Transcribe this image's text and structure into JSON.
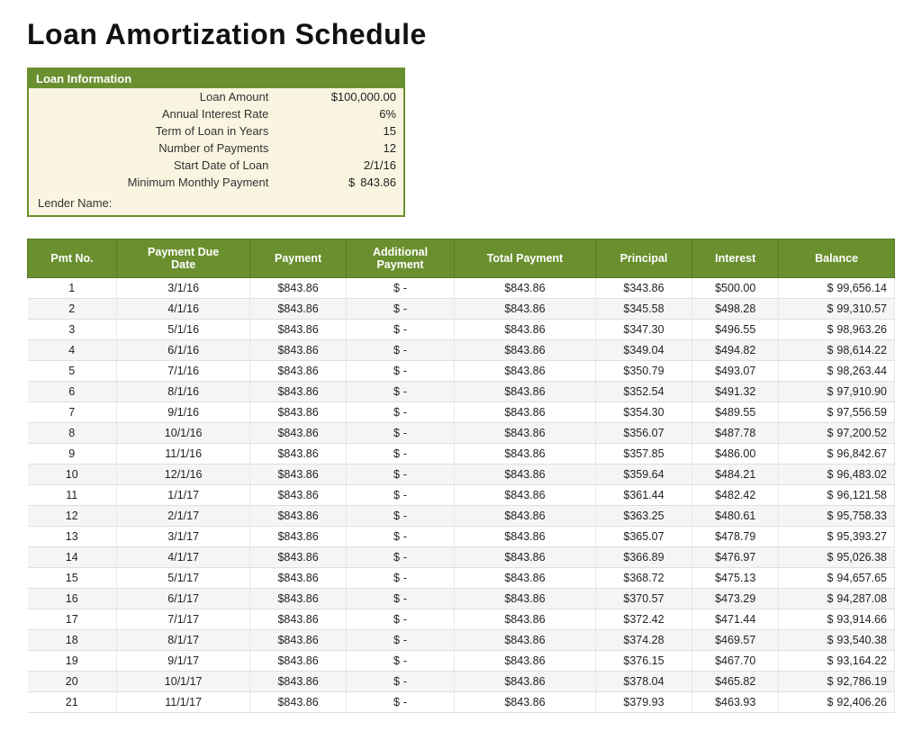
{
  "title": "Loan Amortization Schedule",
  "loanInfo": {
    "sectionTitle": "Loan Information",
    "fields": [
      {
        "label": "Loan Amount",
        "value": "$100,000.00"
      },
      {
        "label": "Annual Interest Rate",
        "value": "6%"
      },
      {
        "label": "Term of Loan in Years",
        "value": "15"
      },
      {
        "label": "Number of Payments",
        "value": "12"
      },
      {
        "label": "Start Date of Loan",
        "value": "2/1/16"
      },
      {
        "label": "Minimum Monthly Payment",
        "value": "843.86",
        "prefix": "$"
      }
    ],
    "lenderLabel": "Lender Name:"
  },
  "table": {
    "headers": [
      "Pmt No.",
      "Payment Due Date",
      "Payment",
      "Additional Payment",
      "Total Payment",
      "Principal",
      "Interest",
      "Balance"
    ],
    "rows": [
      [
        1,
        "3/1/16",
        "$843.86",
        "$",
        "-",
        "$843.86",
        "$343.86",
        "$500.00",
        "$",
        "99,656.14"
      ],
      [
        2,
        "4/1/16",
        "$843.86",
        "$",
        "-",
        "$843.86",
        "$345.58",
        "$498.28",
        "$",
        "99,310.57"
      ],
      [
        3,
        "5/1/16",
        "$843.86",
        "$",
        "-",
        "$843.86",
        "$347.30",
        "$496.55",
        "$",
        "98,963.26"
      ],
      [
        4,
        "6/1/16",
        "$843.86",
        "$",
        "-",
        "$843.86",
        "$349.04",
        "$494.82",
        "$",
        "98,614.22"
      ],
      [
        5,
        "7/1/16",
        "$843.86",
        "$",
        "-",
        "$843.86",
        "$350.79",
        "$493.07",
        "$",
        "98,263.44"
      ],
      [
        6,
        "8/1/16",
        "$843.86",
        "$",
        "-",
        "$843.86",
        "$352.54",
        "$491.32",
        "$",
        "97,910.90"
      ],
      [
        7,
        "9/1/16",
        "$843.86",
        "$",
        "-",
        "$843.86",
        "$354.30",
        "$489.55",
        "$",
        "97,556.59"
      ],
      [
        8,
        "10/1/16",
        "$843.86",
        "$",
        "-",
        "$843.86",
        "$356.07",
        "$487.78",
        "$",
        "97,200.52"
      ],
      [
        9,
        "11/1/16",
        "$843.86",
        "$",
        "-",
        "$843.86",
        "$357.85",
        "$486.00",
        "$",
        "96,842.67"
      ],
      [
        10,
        "12/1/16",
        "$843.86",
        "$",
        "-",
        "$843.86",
        "$359.64",
        "$484.21",
        "$",
        "96,483.02"
      ],
      [
        11,
        "1/1/17",
        "$843.86",
        "$",
        "-",
        "$843.86",
        "$361.44",
        "$482.42",
        "$",
        "96,121.58"
      ],
      [
        12,
        "2/1/17",
        "$843.86",
        "$",
        "-",
        "$843.86",
        "$363.25",
        "$480.61",
        "$",
        "95,758.33"
      ],
      [
        13,
        "3/1/17",
        "$843.86",
        "$",
        "-",
        "$843.86",
        "$365.07",
        "$478.79",
        "$",
        "95,393.27"
      ],
      [
        14,
        "4/1/17",
        "$843.86",
        "$",
        "-",
        "$843.86",
        "$366.89",
        "$476.97",
        "$",
        "95,026.38"
      ],
      [
        15,
        "5/1/17",
        "$843.86",
        "$",
        "-",
        "$843.86",
        "$368.72",
        "$475.13",
        "$",
        "94,657.65"
      ],
      [
        16,
        "6/1/17",
        "$843.86",
        "$",
        "-",
        "$843.86",
        "$370.57",
        "$473.29",
        "$",
        "94,287.08"
      ],
      [
        17,
        "7/1/17",
        "$843.86",
        "$",
        "-",
        "$843.86",
        "$372.42",
        "$471.44",
        "$",
        "93,914.66"
      ],
      [
        18,
        "8/1/17",
        "$843.86",
        "$",
        "-",
        "$843.86",
        "$374.28",
        "$469.57",
        "$",
        "93,540.38"
      ],
      [
        19,
        "9/1/17",
        "$843.86",
        "$",
        "-",
        "$843.86",
        "$376.15",
        "$467.70",
        "$",
        "93,164.22"
      ],
      [
        20,
        "10/1/17",
        "$843.86",
        "$",
        "-",
        "$843.86",
        "$378.04",
        "$465.82",
        "$",
        "92,786.19"
      ],
      [
        21,
        "11/1/17",
        "$843.86",
        "$",
        "-",
        "$843.86",
        "$379.93",
        "$463.93",
        "$",
        "92,406.26"
      ]
    ]
  }
}
